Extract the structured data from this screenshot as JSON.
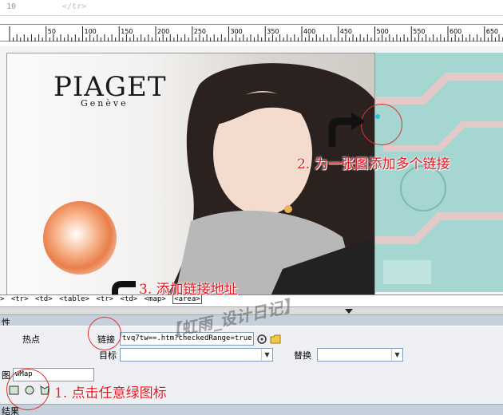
{
  "code_strip": {
    "line_number": "10",
    "code_text": "</tr>"
  },
  "ruler": {
    "ticks": [
      "50",
      "100",
      "150",
      "200",
      "250",
      "300",
      "350",
      "400",
      "450",
      "500",
      "550",
      "600",
      "650"
    ]
  },
  "photo": {
    "brand": "PIAGET",
    "brand_sub": "Genève"
  },
  "annotations": {
    "step1": "1. 点击任意绿图标",
    "step2": "2. 为一张图添加多个链接",
    "step3": "3. 添加链接地址"
  },
  "tag_selector": [
    "<tr>",
    "<td>",
    "<table>",
    "<tr>",
    "<td>",
    "<map>",
    "<area>"
  ],
  "properties": {
    "title": "性",
    "hotspot_label": "热点",
    "link_label": "链接",
    "link_value": "tvq7tw==.htm?checkedRange=true",
    "target_label": "目标",
    "target_value": "",
    "alt_label": "替换",
    "alt_value": "",
    "map_label": "图",
    "map_name": "wMap"
  },
  "footer": {
    "label": "结果"
  },
  "watermark": "【虹雨_设计日记】",
  "colors": {
    "annotation_red": "#e8141e",
    "hotspot_cyan": "#29c3d8",
    "panel_bg": "#eef0f3"
  }
}
